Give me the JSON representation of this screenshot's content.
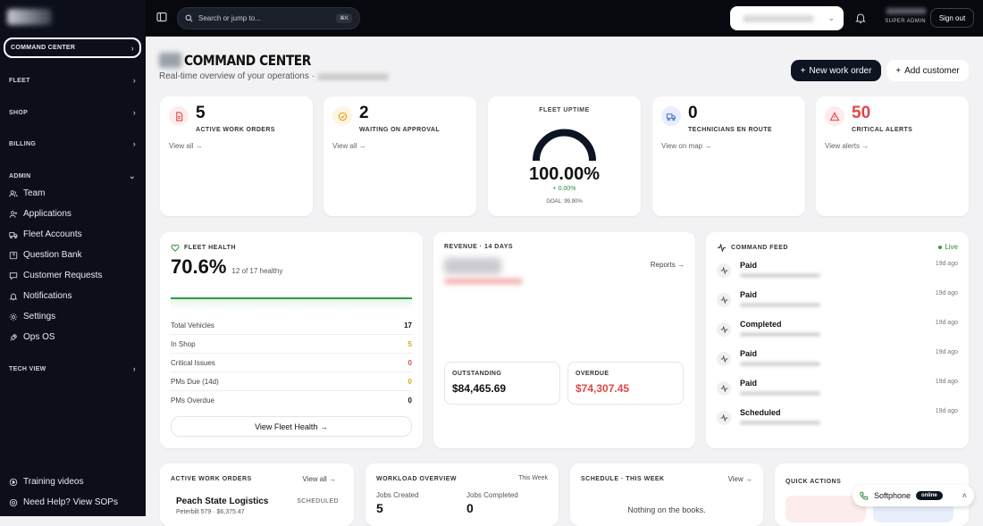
{
  "sidebar": {
    "active": "COMMAND CENTER",
    "sections": [
      {
        "label": "FLEET"
      },
      {
        "label": "SHOP"
      },
      {
        "label": "BILLING"
      },
      {
        "label": "ADMIN"
      },
      {
        "label": "TECH VIEW"
      }
    ],
    "admin_items": [
      {
        "label": "Team",
        "icon": "team-icon"
      },
      {
        "label": "Applications",
        "icon": "user-plus-icon"
      },
      {
        "label": "Fleet Accounts",
        "icon": "truck-icon"
      },
      {
        "label": "Question Bank",
        "icon": "question-icon"
      },
      {
        "label": "Customer Requests",
        "icon": "chat-icon"
      },
      {
        "label": "Notifications",
        "icon": "bell-icon"
      },
      {
        "label": "Settings",
        "icon": "gear-icon"
      },
      {
        "label": "Ops OS",
        "icon": "rocket-icon"
      }
    ],
    "footer": [
      {
        "label": "Training videos",
        "icon": "play-icon"
      },
      {
        "label": "Need Help? View SOPs",
        "icon": "help-icon"
      }
    ]
  },
  "topbar": {
    "search_placeholder": "Search or jump to...",
    "shortcut": "⌘K",
    "role": "SUPER ADMIN",
    "signout": "Sign out"
  },
  "header": {
    "title": "COMMAND CENTER",
    "subtitle": "Real-time overview of your operations ·",
    "new_work_order": "New work order",
    "add_customer": "Add customer"
  },
  "stats": [
    {
      "value": "5",
      "label": "ACTIVE WORK ORDERS",
      "link": "View all →",
      "icon": "document-icon",
      "color": "#e04646",
      "bg": "#fdecec"
    },
    {
      "value": "2",
      "label": "WAITING ON APPROVAL",
      "link": "View all →",
      "icon": "clock-check-icon",
      "color": "#e0a21b",
      "bg": "#fdf4e3"
    },
    {
      "value": "0",
      "label": "TECHNICIANS EN ROUTE",
      "link": "View on map →",
      "icon": "truck-icon",
      "color": "#4a6fd8",
      "bg": "#e8eefb"
    },
    {
      "value": "50",
      "label": "CRITICAL ALERTS",
      "link": "View alerts →",
      "icon": "warning-icon",
      "color": "#e04646",
      "bg": "#fdecec"
    }
  ],
  "gauge": {
    "title": "FLEET UPTIME",
    "value": "100.00%",
    "fraction": 1.0,
    "delta": "+ 0.00%",
    "goal": "GOAL: 99.90%"
  },
  "fleet_health": {
    "title": "FLEET HEALTH",
    "value": "70.6%",
    "sub": "12 of 17 healthy",
    "rows": [
      {
        "label": "Total Vehicles",
        "value": "17",
        "color": "#111"
      },
      {
        "label": "In Shop",
        "value": "5",
        "color": "#e0a21b"
      },
      {
        "label": "Critical Issues",
        "value": "0",
        "color": "#e04646"
      },
      {
        "label": "PMs Due (14d)",
        "value": "0",
        "color": "#e0a21b"
      },
      {
        "label": "PMs Overdue",
        "value": "0",
        "color": "#111"
      }
    ],
    "button": "View Fleet Health →"
  },
  "revenue": {
    "title": "REVENUE · 14 DAYS",
    "reports": "Reports →",
    "outstanding_label": "OUTSTANDING",
    "outstanding": "$84,465.69",
    "overdue_label": "OVERDUE",
    "overdue": "$74,307.45"
  },
  "feed": {
    "title": "COMMAND FEED",
    "live": "Live",
    "items": [
      {
        "title": "Paid",
        "age": "19d ago"
      },
      {
        "title": "Paid",
        "age": "19d ago"
      },
      {
        "title": "Completed",
        "age": "19d ago"
      },
      {
        "title": "Paid",
        "age": "19d ago"
      },
      {
        "title": "Paid",
        "age": "19d ago"
      },
      {
        "title": "Scheduled",
        "age": "19d ago"
      }
    ]
  },
  "bottom": {
    "awo_title": "ACTIVE WORK ORDERS",
    "awo_link": "View all →",
    "awo_name": "Peach State Logistics",
    "awo_status": "SCHEDULED",
    "awo_sub": "Peterbilt 579 · $6,375.47",
    "wl_title": "WORKLOAD OVERVIEW",
    "wl_period": "This Week",
    "wl_created_label": "Jobs Created",
    "wl_created": "5",
    "wl_completed_label": "Jobs Completed",
    "wl_completed": "0",
    "sch_title": "SCHEDULE · THIS WEEK",
    "sch_link": "View →",
    "sch_empty": "Nothing on the books.",
    "qa_title": "QUICK ACTIONS"
  },
  "softphone": {
    "label": "Softphone",
    "status": "online"
  }
}
